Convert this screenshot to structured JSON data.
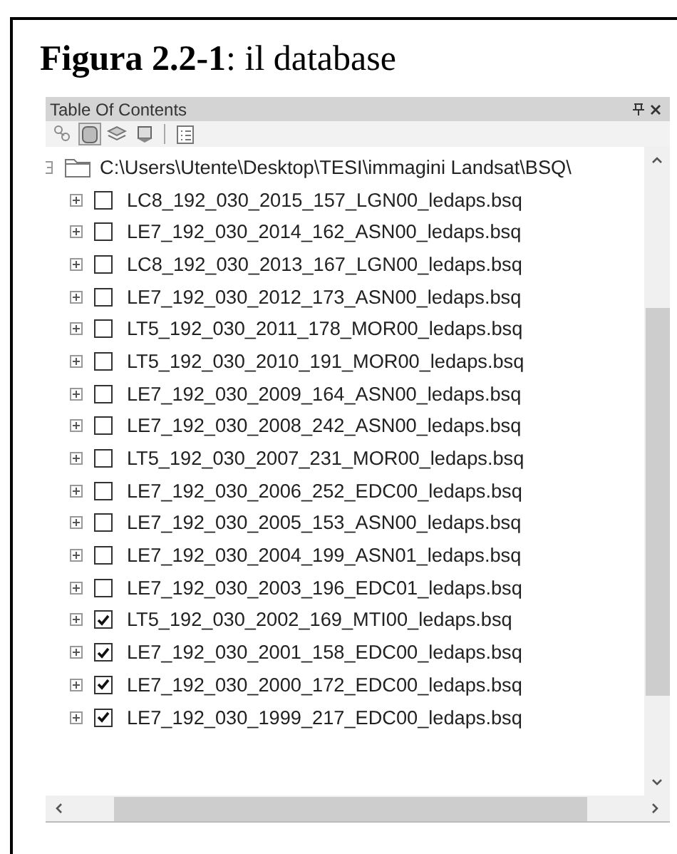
{
  "caption": "**Figura 2.2-1**: il database",
  "panel": {
    "title": "Table Of Contents",
    "tools": [
      {
        "kind": "drawing-order",
        "selected": false
      },
      {
        "kind": "source",
        "selected": true
      },
      {
        "kind": "visibility",
        "selected": false
      },
      {
        "kind": "selection",
        "selected": false
      },
      {
        "kind": "options",
        "selected": false
      }
    ],
    "folder": "C:\\Users\\Utente\\Desktop\\TESI\\immagini Landsat\\BSQ\\",
    "layers": [
      {
        "name": "LC8_192_030_2015_157_LGN00_ledaps.bsq",
        "checked": false
      },
      {
        "name": "LE7_192_030_2014_162_ASN00_ledaps.bsq",
        "checked": false
      },
      {
        "name": "LC8_192_030_2013_167_LGN00_ledaps.bsq",
        "checked": false
      },
      {
        "name": "LE7_192_030_2012_173_ASN00_ledaps.bsq",
        "checked": false
      },
      {
        "name": "LT5_192_030_2011_178_MOR00_ledaps.bsq",
        "checked": false
      },
      {
        "name": "LT5_192_030_2010_191_MOR00_ledaps.bsq",
        "checked": false
      },
      {
        "name": "LE7_192_030_2009_164_ASN00_ledaps.bsq",
        "checked": false
      },
      {
        "name": "LE7_192_030_2008_242_ASN00_ledaps.bsq",
        "checked": false
      },
      {
        "name": "LT5_192_030_2007_231_MOR00_ledaps.bsq",
        "checked": false
      },
      {
        "name": "LE7_192_030_2006_252_EDC00_ledaps.bsq",
        "checked": false
      },
      {
        "name": "LE7_192_030_2005_153_ASN00_ledaps.bsq",
        "checked": false
      },
      {
        "name": "LE7_192_030_2004_199_ASN01_ledaps.bsq",
        "checked": false
      },
      {
        "name": "LE7_192_030_2003_196_EDC01_ledaps.bsq",
        "checked": false
      },
      {
        "name": "LT5_192_030_2002_169_MTI00_ledaps.bsq",
        "checked": true
      },
      {
        "name": "LE7_192_030_2001_158_EDC00_ledaps.bsq",
        "checked": true
      },
      {
        "name": "LE7_192_030_2000_172_EDC00_ledaps.bsq",
        "checked": true
      },
      {
        "name": "LE7_192_030_1999_217_EDC00_ledaps.bsq",
        "checked": true
      }
    ]
  }
}
